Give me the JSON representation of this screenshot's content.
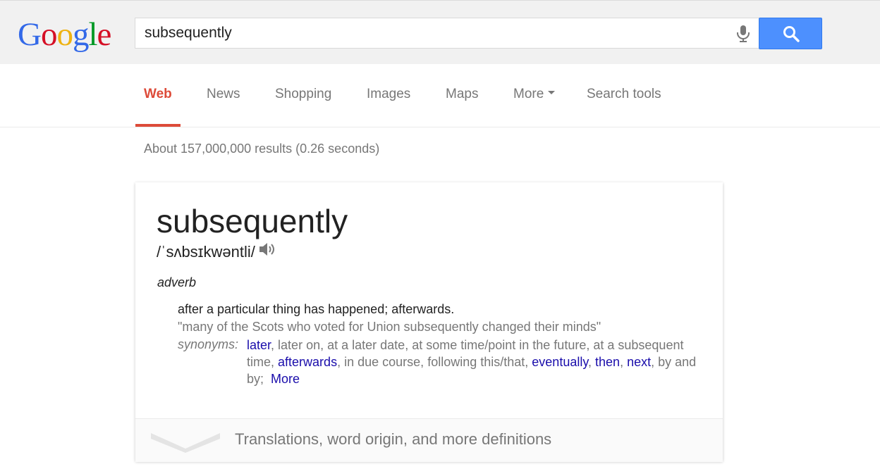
{
  "header": {
    "logo_letters": [
      {
        "char": "G",
        "color": "#3369e8"
      },
      {
        "char": "o",
        "color": "#d50f25"
      },
      {
        "char": "o",
        "color": "#eeb211"
      },
      {
        "char": "g",
        "color": "#3369e8"
      },
      {
        "char": "l",
        "color": "#009925"
      },
      {
        "char": "e",
        "color": "#d50f25"
      }
    ],
    "query": "subsequently",
    "mic_icon": "microphone",
    "search_icon": "magnifier"
  },
  "nav": {
    "tabs": [
      {
        "label": "Web",
        "active": true
      },
      {
        "label": "News"
      },
      {
        "label": "Shopping"
      },
      {
        "label": "Images"
      },
      {
        "label": "Maps"
      },
      {
        "label": "More"
      },
      {
        "label": "Search tools"
      }
    ]
  },
  "results": {
    "stats": "About 157,000,000 results (0.26 seconds)"
  },
  "dictionary": {
    "word": "subsequently",
    "phonetic": "/ˈsʌbsɪkwəntli/",
    "part_of_speech": "adverb",
    "definition": "after a particular thing has happened; afterwards.",
    "example": "\"many of the Scots who voted for Union subsequently changed their minds\"",
    "synonyms_label": "synonyms:",
    "synonyms": [
      {
        "text": "later",
        "link": true
      },
      {
        "text": "later on",
        "link": false
      },
      {
        "text": "at a later date",
        "link": false
      },
      {
        "text": "at some time/point in the future",
        "link": false
      },
      {
        "text": "at a subsequent time",
        "link": false
      },
      {
        "text": "afterwards",
        "link": true
      },
      {
        "text": "in due course",
        "link": false
      },
      {
        "text": "following this/that",
        "link": false
      },
      {
        "text": "eventually",
        "link": true
      },
      {
        "text": "then",
        "link": true
      },
      {
        "text": "next",
        "link": true
      },
      {
        "text": "by and by",
        "link": false
      }
    ],
    "more_link": "More",
    "footer_text": "Translations, word origin, and more definitions",
    "speaker_icon": "speaker",
    "expand_icon": "chevron-down"
  },
  "colors": {
    "accent_red": "#dd4b39",
    "link_blue": "#1a0dab",
    "button_blue": "#4d90fe"
  }
}
